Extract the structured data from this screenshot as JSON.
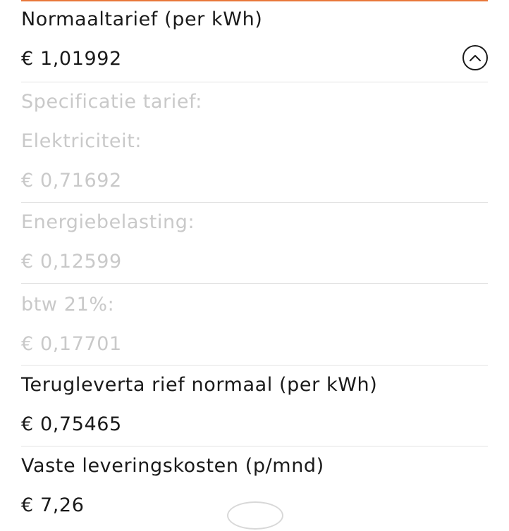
{
  "normal_rate": {
    "label": "Normaaltarief (per kWh)",
    "value": "€ 1,01992",
    "collapse_icon": "chevron-up-icon"
  },
  "specification": {
    "heading": "Specificatie tarief:",
    "items": [
      {
        "label": "Elektriciteit:",
        "value": "€ 0,71692"
      },
      {
        "label": "Energiebelasting:",
        "value": "€ 0,12599"
      },
      {
        "label": "btw 21%:",
        "value": "€ 0,17701"
      }
    ]
  },
  "return_rate": {
    "label": "Terugleverta rief normaal (per kWh)",
    "value": "€ 0,75465"
  },
  "fixed_costs": {
    "label": "Vaste leveringskosten (p/mnd)",
    "value": "€ 7,26"
  },
  "colors": {
    "accent": "#e8773a",
    "text": "#1a1a1a",
    "muted": "#c9c9c9",
    "divider": "#e3e3e3"
  }
}
